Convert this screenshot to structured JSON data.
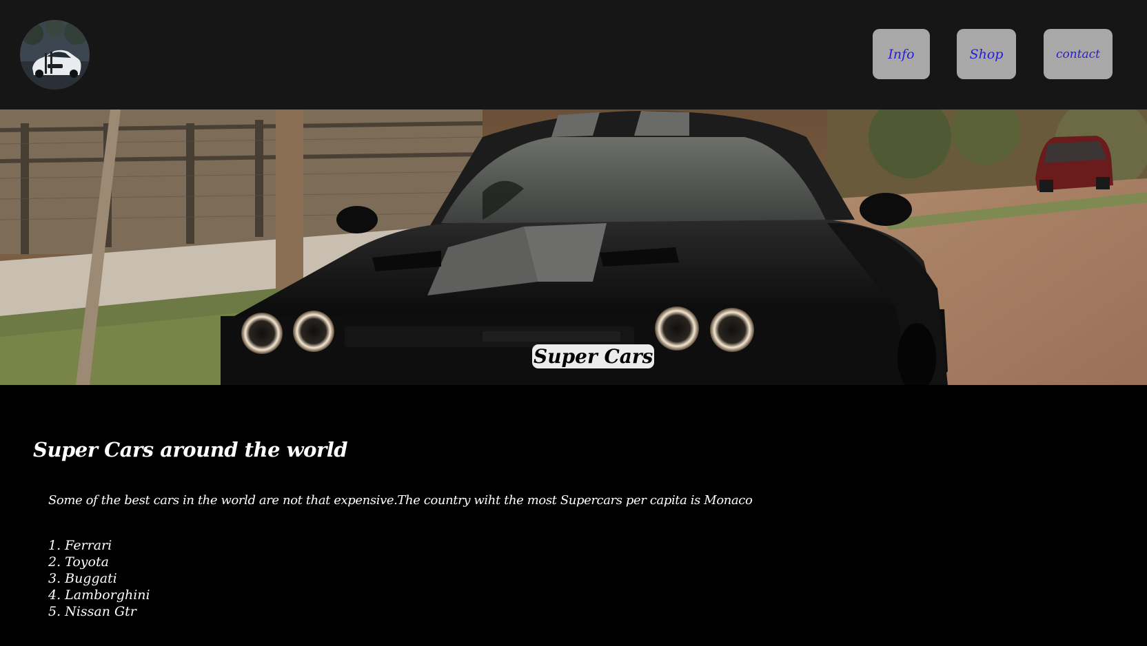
{
  "header": {
    "logo": {
      "icon": "car-logo-icon"
    },
    "nav": [
      {
        "label": "Info"
      },
      {
        "label": "Shop"
      },
      {
        "label": "contact"
      }
    ]
  },
  "hero": {
    "image": "black-muscle-car-photo",
    "title": "Super Cars"
  },
  "content": {
    "heading": "Super Cars around the world",
    "paragraph": "Some of the best cars in the world are not that expensive.The country wiht the most Supercars per capita is Monaco",
    "list": [
      "Ferrari",
      "Toyota",
      "Buggati",
      "Lamborghini",
      "Nissan Gtr"
    ]
  },
  "colors": {
    "header_bg": "#161616",
    "page_bg": "#000000",
    "nav_button_bg": "#a8a8a8",
    "nav_text": "#2a1bd6",
    "text": "#ffffff"
  }
}
